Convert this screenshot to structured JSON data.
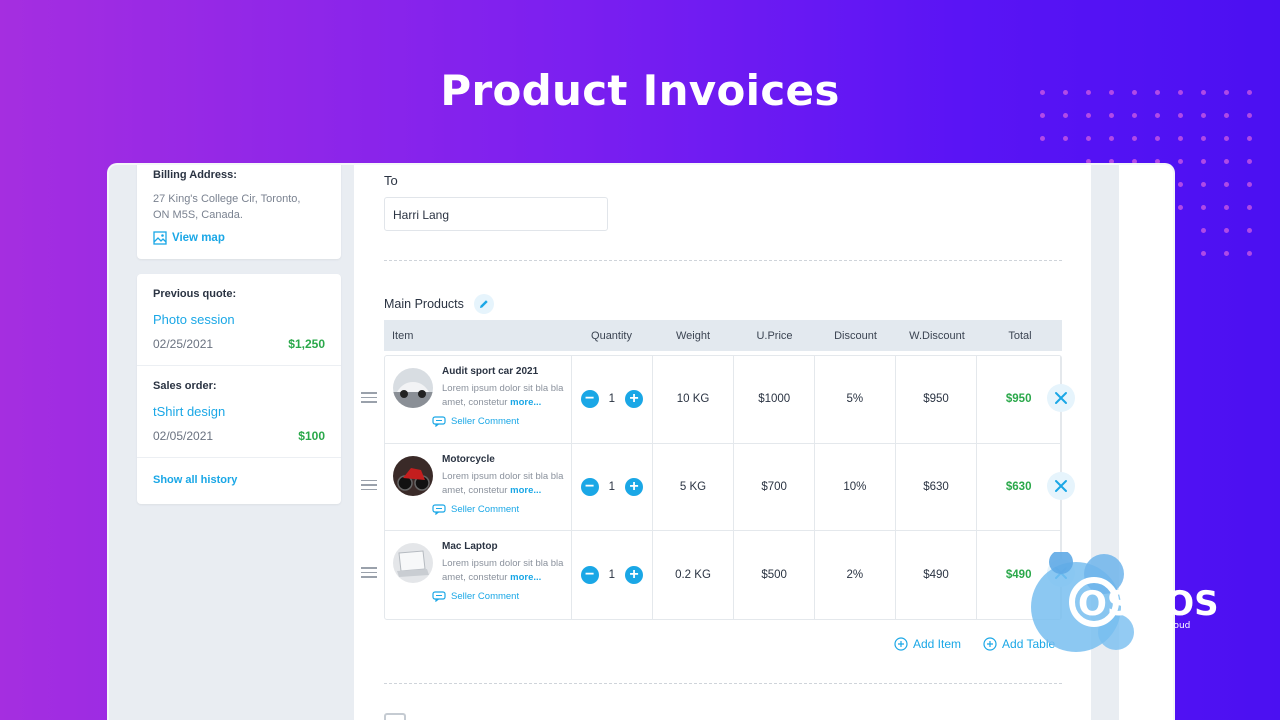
{
  "hero": {
    "title": "Product Invoices"
  },
  "billing": {
    "label": "Billing Address:",
    "address_line1": "27 King's College Cir, Toronto,",
    "address_line2": "ON M5S, Canada.",
    "view_map": "View map"
  },
  "history": {
    "previous_quote": {
      "label": "Previous quote:",
      "name": "Photo session",
      "date": "02/25/2021",
      "amount": "$1,250"
    },
    "sales_order": {
      "label": "Sales order:",
      "name": "tShirt design",
      "date": "02/05/2021",
      "amount": "$100"
    },
    "show_all": "Show all history"
  },
  "invoice": {
    "to_label": "To",
    "to_value": "Harri Lang",
    "products_title": "Main Products",
    "columns": [
      "Item",
      "Quantity",
      "Weight",
      "U.Price",
      "Discount",
      "W.Discount",
      "Total"
    ],
    "rows": [
      {
        "name": "Audit sport car 2021",
        "desc": "Lorem ipsum dolor sit bla bla amet, constetur",
        "more": "more...",
        "seller": "Seller Comment",
        "qty": "1",
        "weight": "10 KG",
        "uprice": "$1000",
        "discount": "5%",
        "wdiscount": "$950",
        "total": "$950"
      },
      {
        "name": "Motorcycle",
        "desc": "Lorem ipsum dolor sit bla bla amet, constetur",
        "more": "more...",
        "seller": "Seller Comment",
        "qty": "1",
        "weight": "5 KG",
        "uprice": "$700",
        "discount": "10%",
        "wdiscount": "$630",
        "total": "$630"
      },
      {
        "name": "Mac Laptop",
        "desc": "Lorem ipsum dolor sit bla bla amet, constetur",
        "more": "more...",
        "seller": "Seller Comment",
        "qty": "1",
        "weight": "0.2 KG",
        "uprice": "$500",
        "discount": "2%",
        "wdiscount": "$490",
        "total": "$490"
      }
    ],
    "add_item": "Add Item",
    "add_table": "Add Table"
  },
  "logo": {
    "text": "OSMOS",
    "sub": "cloud"
  },
  "colors": {
    "accent": "#1aa7e6",
    "total_green": "#2aa84a",
    "bg_start": "#a52ee0",
    "bg_end": "#4b10f2"
  }
}
